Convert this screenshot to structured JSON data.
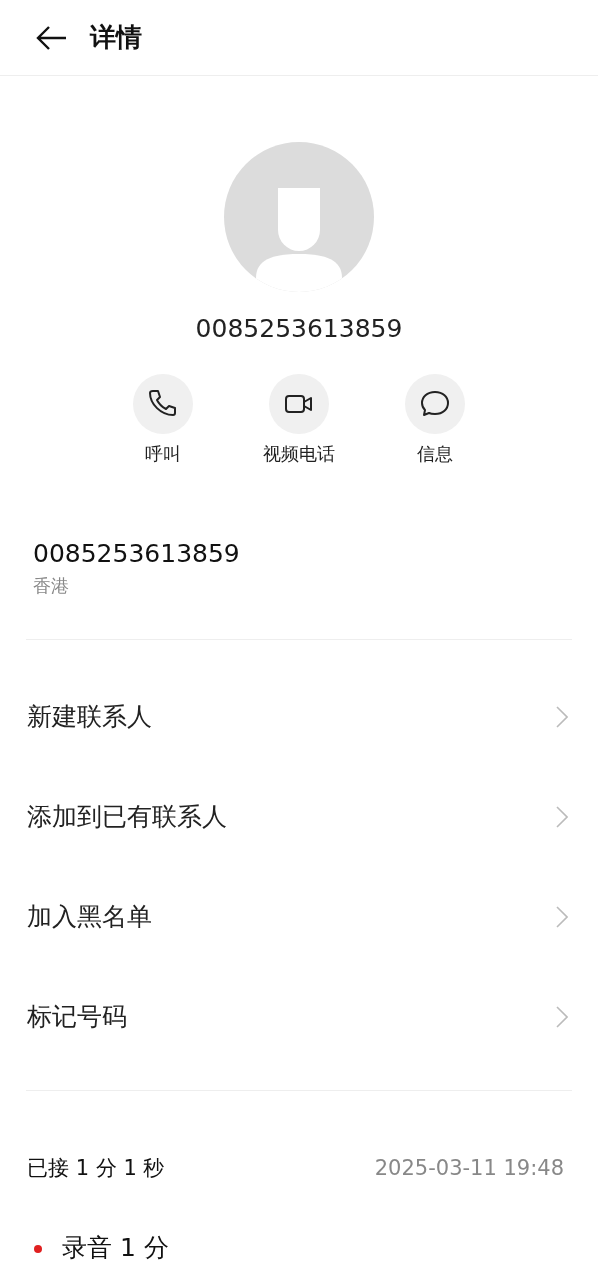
{
  "header": {
    "title": "详情"
  },
  "contact": {
    "number": "0085253613859"
  },
  "actions": [
    {
      "kind": "call",
      "label": "呼叫"
    },
    {
      "kind": "video",
      "label": "视频电话"
    },
    {
      "kind": "message",
      "label": "信息"
    }
  ],
  "number_info": {
    "number": "0085253613859",
    "location": "香港"
  },
  "menu": [
    {
      "label": "新建联系人"
    },
    {
      "label": "添加到已有联系人"
    },
    {
      "label": "加入黑名单"
    },
    {
      "label": "标记号码"
    }
  ],
  "call_log": [
    {
      "status": "已接 1 分 1 秒",
      "time": "2025-03-11 19:48"
    }
  ],
  "recording": {
    "label": "录音 1 分"
  }
}
